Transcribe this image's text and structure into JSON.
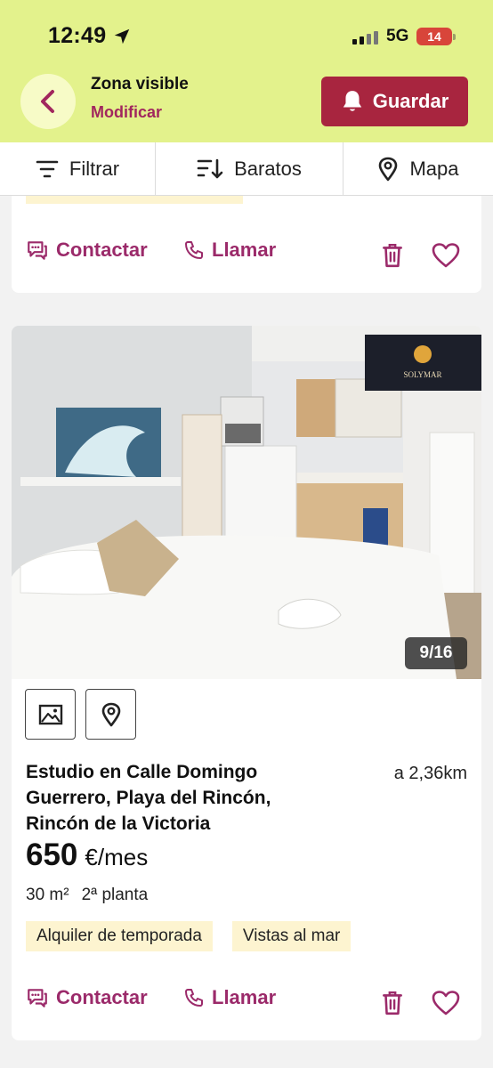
{
  "status_bar": {
    "time": "12:49",
    "network": "5G",
    "battery": "14"
  },
  "header": {
    "title": "Zona visible",
    "subtitle": "Modificar",
    "save_label": "Guardar"
  },
  "toolbar": {
    "filter_label": "Filtrar",
    "sort_label": "Baratos",
    "map_label": "Mapa"
  },
  "actions": {
    "contact_label": "Contactar",
    "call_label": "Llamar"
  },
  "listing": {
    "photo_counter": "9/16",
    "watermark": "SOLYMAR",
    "title": "Estudio en Calle Domingo Guerrero, Playa del Rincón, Rincón de la Victoria",
    "distance": "a 2,36km",
    "price": "650",
    "price_unit": "€/mes",
    "size": "30 m²",
    "floor": "2ª planta",
    "tags": [
      "Alquiler de temporada",
      "Vistas al mar"
    ]
  },
  "colors": {
    "header_bg": "#e3f28c",
    "accent": "#9b2a6a",
    "save_bg": "#a8253f",
    "tag_bg": "#fdf4d0"
  }
}
